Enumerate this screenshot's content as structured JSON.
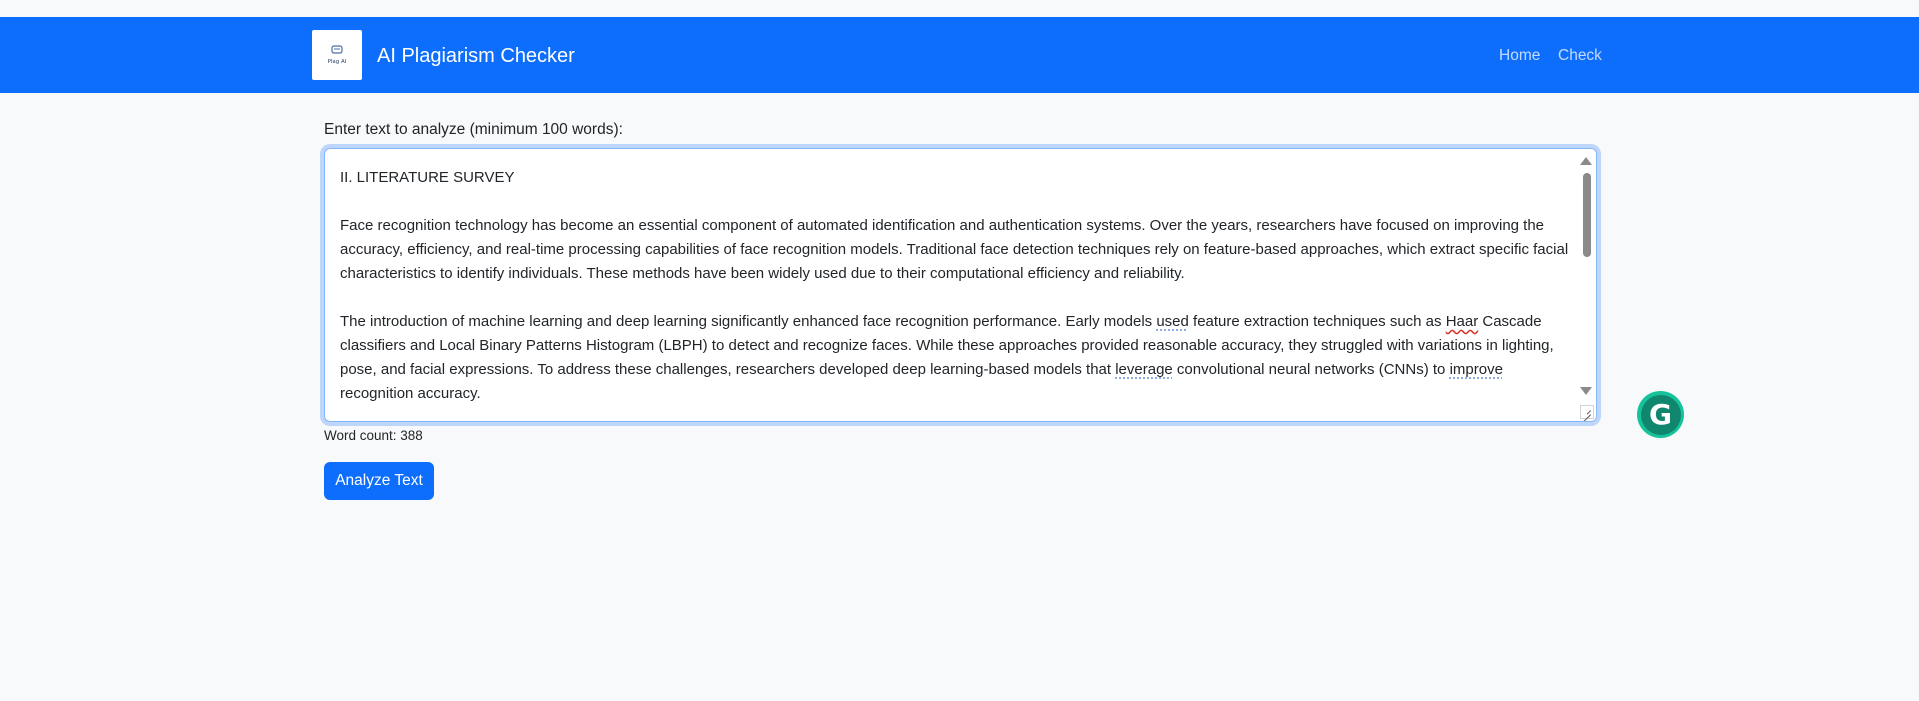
{
  "navbar": {
    "title": "AI Plagiarism Checker",
    "logo_text": "Plag AI",
    "links": [
      "Home",
      "Check"
    ],
    "bg_color": "#0d6efd"
  },
  "form": {
    "label": "Enter text to analyze (minimum 100 words):",
    "textarea": {
      "heading": "II. LITERATURE SURVEY",
      "paragraph1": "Face recognition technology has become an essential component of automated identification and authentication systems. Over the years, researchers have focused on improving the accuracy, efficiency, and real-time processing capabilities of face recognition models. Traditional face detection techniques rely on feature-based approaches, which extract specific facial characteristics to identify individuals. These methods have been widely used due to their computational efficiency and reliability.",
      "p2_parts": [
        "The introduction of machine learning and deep learning significantly enhanced face recognition performance. Early models ",
        "used",
        " feature extraction techniques such as ",
        "Haar",
        " Cascade classifiers and Local Binary Patterns Histogram (LBPH) to detect and recognize faces. While these approaches provided reasonable accuracy, they struggled with variations in lighting, pose, and facial expressions. To address these challenges, researchers developed deep learning-based models that ",
        "leverage",
        " convolutional neural networks (CNNs) to ",
        "improve",
        " recognition accuracy."
      ]
    },
    "word_count": "Word count: 388",
    "analyze_button": "Analyze Text"
  },
  "grammarly": {
    "icon": "grammarly-icon",
    "letter": "G"
  }
}
